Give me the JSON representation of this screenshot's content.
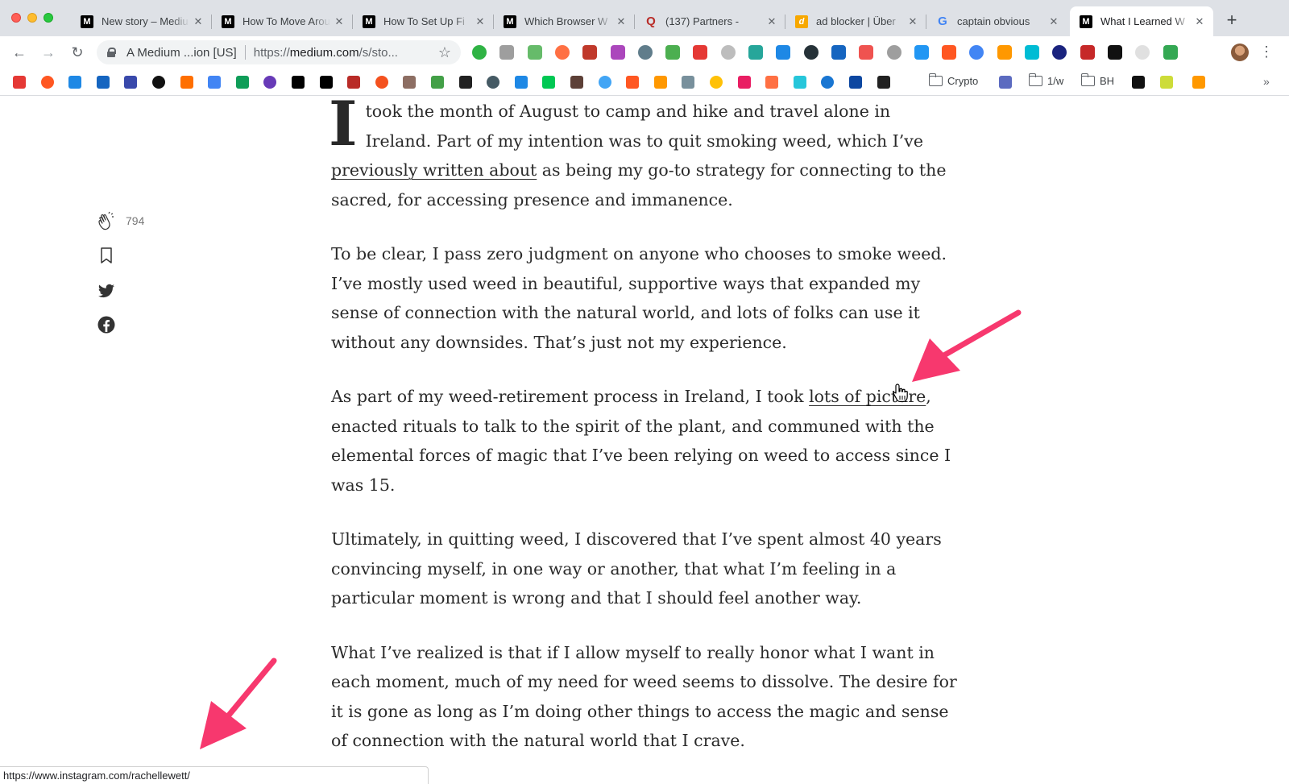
{
  "browser": {
    "tabs": [
      {
        "title": "New story – Medium",
        "favicon": "medium-icon",
        "color": "#000000",
        "glyph": "M"
      },
      {
        "title": "How To Move Around",
        "favicon": "medium-icon",
        "color": "#000000",
        "glyph": "M"
      },
      {
        "title": "How To Set Up Fi",
        "favicon": "medium-icon",
        "color": "#000000",
        "glyph": "M"
      },
      {
        "title": "Which Browser W",
        "favicon": "medium-icon",
        "color": "#000000",
        "glyph": "M"
      },
      {
        "title": "(137) Partners -",
        "favicon": "quora-icon",
        "color": "#b92b27",
        "glyph": "Q"
      },
      {
        "title": "ad blocker | Über",
        "favicon": "dict-icon",
        "color": "#f7a800",
        "glyph": "d"
      },
      {
        "title": "captain obvious",
        "favicon": "google-icon",
        "color": "#4285f4",
        "glyph": "G"
      },
      {
        "title": "What I Learned W",
        "favicon": "medium-icon",
        "color": "#000000",
        "glyph": "M"
      }
    ],
    "omnibox": {
      "site_label": "A Medium ...ion [US]",
      "url_prefix": "https://",
      "url_host": "medium.com",
      "url_path": "/s/sto..."
    },
    "bookmarks": {
      "folders": [
        "Crypto",
        "1/w",
        "BH"
      ],
      "more": "»"
    }
  },
  "article": {
    "dropcap": "I",
    "paragraphs": [
      {
        "parts": [
          {
            "text": " took the month of August to camp and hike and travel alone in Ireland. Part of my intention was to quit smoking weed, which I’ve "
          },
          {
            "text": "previously written about",
            "link": true
          },
          {
            "text": " as being my go-to strategy for connecting to the sacred, for accessing presence and immanence."
          }
        ]
      },
      {
        "parts": [
          {
            "text": "To be clear, I pass zero judgment on anyone who chooses to smoke weed. I’ve mostly used weed in beautiful, supportive ways that expanded my sense of connection with the natural world, and lots of folks can use it without any downsides. That’s just not my experience."
          }
        ]
      },
      {
        "parts": [
          {
            "text": "As part of my weed-retirement process in Ireland, I took "
          },
          {
            "text": "lots of picture",
            "link": true
          },
          {
            "text": ", enacted rituals to talk to the spirit of the plant, and communed with the elemental forces of magic that I’ve been relying on weed to access since I was 15."
          }
        ]
      },
      {
        "parts": [
          {
            "text": "Ultimately, in quitting weed, I discovered that I’ve spent almost 40 years convincing myself, in one way or another, that what I’m feeling in a particular moment is wrong and that I should feel another way."
          }
        ]
      },
      {
        "parts": [
          {
            "text": "What I’ve realized is that if I allow myself to really honor what I want in each moment, much of my need for weed seems to dissolve. The desire for it is gone as long as I’m doing other things to access the magic and sense of connection with the natural world that I crave."
          }
        ]
      }
    ]
  },
  "share": {
    "clap_count": "794",
    "icons": [
      "clap-icon",
      "bookmark-icon",
      "twitter-icon",
      "facebook-icon"
    ]
  },
  "status_bar": {
    "url": "https://www.instagram.com/rachellewett/"
  },
  "annotations": {
    "arrow_color": "#f7386e"
  }
}
